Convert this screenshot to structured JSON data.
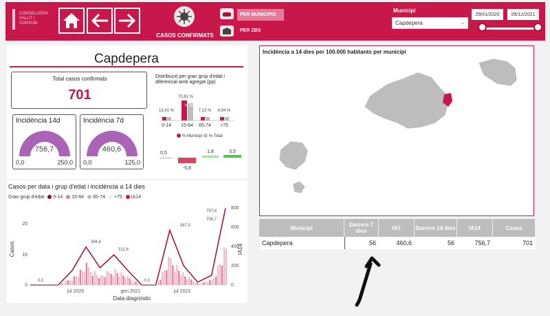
{
  "header": {
    "logo_line1": "CONSELLERIA",
    "logo_line2": "SALUT I CONSUM",
    "covid_label": "CASOS CONFIRMATS",
    "option_municipis": "PER MUNICIPIS",
    "option_zbs": "PER ZBS",
    "municipi_label": "Municipi",
    "municipi_value": "Capdepera",
    "date_from": "29/01/2020",
    "date_to": "09/12/2021"
  },
  "left": {
    "title": "Capdepera",
    "total_label": "Total casos confirmats",
    "total_value": "701",
    "inc14": {
      "title": "Incidència 14d",
      "value": "756,7",
      "min": "0,0",
      "max": "250,0"
    },
    "inc7": {
      "title": "Incidència 7d",
      "value": "460,6",
      "min": "0,0",
      "max": "125,0"
    },
    "dist_title": "Distribució per gran grup d'edat i diferencial amb agregat (pp)",
    "dist": {
      "groups": [
        "0-14",
        "15-64",
        "65-74",
        "+75"
      ],
      "municipi_pct": [
        13.41,
        76.18,
        7.13,
        8.84
      ],
      "total_pct_labels": [
        "13,41 %",
        "70,61 %",
        "7,13 %",
        "8,84 %"
      ],
      "inner_label": "76,18",
      "legend_municipi": "% Municipi",
      "legend_total": "% Total",
      "diff_labels": [
        "0,5",
        "-5,8",
        "1,8",
        "3,5"
      ],
      "diff_values": [
        0.5,
        -5.8,
        1.8,
        3.5
      ]
    }
  },
  "chart": {
    "title": "Casos per data i grup d'edat i incidència a 14 dies",
    "legend_title": "Gran grup d'edat",
    "legend_items": [
      "0-14",
      "15-64",
      "65-74",
      "+75",
      "IA14"
    ],
    "xlabel": "Data diagnòstic",
    "ylabel_left": "Casos",
    "ylabel_right": "IA14",
    "x_ticks": [
      "jul 2020",
      "gen 2021",
      "jul 2021"
    ],
    "y_ticks_left": [
      "0",
      "10",
      "20"
    ],
    "y_ticks_right": [
      "0",
      "200",
      "400",
      "600",
      "800"
    ],
    "annotations": [
      "0,0",
      "394,8",
      "312,6",
      "0,0",
      "567,5",
      "797,8",
      "756,7"
    ]
  },
  "chart_data": {
    "type": "line",
    "title": "Casos per data i grup d'edat i incidència a 14 dies",
    "xlabel": "Data diagnòstic",
    "ylabel": "IA14",
    "x": [
      "2020-03",
      "2020-05",
      "2020-07",
      "2020-09",
      "2020-10",
      "2020-12",
      "2021-01",
      "2021-02",
      "2021-04",
      "2021-06",
      "2021-07",
      "2021-08",
      "2021-10",
      "2021-11",
      "2021-12"
    ],
    "series": [
      {
        "name": "IA14",
        "values": [
          0,
          0,
          0,
          150,
          394.8,
          180,
          312.6,
          150,
          0,
          0,
          567.5,
          200,
          30,
          100,
          797.8
        ]
      }
    ],
    "ylim": [
      0,
      800
    ]
  },
  "map": {
    "title": "Incidència a 14 dies per 100.000 habitants per municipi"
  },
  "table": {
    "headers": [
      "Municipi",
      "Darrers 7 dies",
      "IA7",
      "Darrers 14 dies",
      "IA14",
      "Casos"
    ],
    "rows": [
      {
        "municipi": "Capdepera",
        "d7": "56",
        "ia7": "460,6",
        "d14": "56",
        "ia14": "756,7",
        "casos": "701"
      }
    ]
  },
  "colors": {
    "brand": "#c8174b",
    "gauge": "#a964b5",
    "grey": "#bdbdbd"
  }
}
